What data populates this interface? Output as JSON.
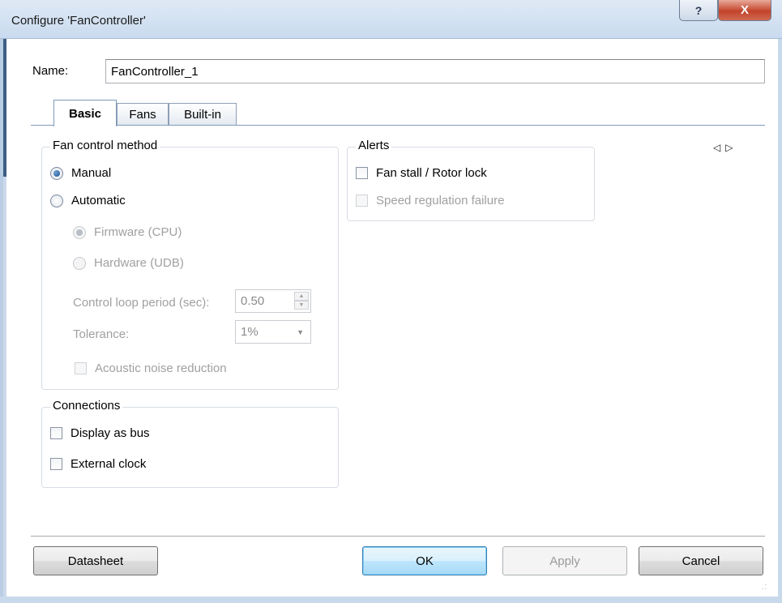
{
  "window": {
    "title": "Configure 'FanController'",
    "help_glyph": "?",
    "close_glyph": "X"
  },
  "name_row": {
    "label": "Name:",
    "value": "FanController_1"
  },
  "tabs": [
    {
      "label": "Basic",
      "selected": true
    },
    {
      "label": "Fans",
      "selected": false
    },
    {
      "label": "Built-in",
      "selected": false
    }
  ],
  "tab_scroll": {
    "left": "◁",
    "right": "▷"
  },
  "fan_control": {
    "title": "Fan control method",
    "manual": {
      "label": "Manual",
      "checked": true
    },
    "automatic": {
      "label": "Automatic",
      "checked": false
    },
    "firmware": {
      "label": "Firmware (CPU)",
      "checked": true,
      "enabled": false
    },
    "hardware": {
      "label": "Hardware (UDB)",
      "checked": false,
      "enabled": false
    },
    "control_loop": {
      "label": "Control loop period (sec):",
      "value": "0.50"
    },
    "tolerance": {
      "label": "Tolerance:",
      "value": "1%"
    },
    "acoustic": {
      "label": "Acoustic noise reduction",
      "checked": false,
      "enabled": false
    }
  },
  "alerts": {
    "title": "Alerts",
    "fan_stall": {
      "label": "Fan stall / Rotor lock",
      "checked": false
    },
    "speed_failure": {
      "label": "Speed regulation failure",
      "checked": false,
      "enabled": false
    }
  },
  "connections": {
    "title": "Connections",
    "display_bus": {
      "label": "Display as bus",
      "checked": false
    },
    "external_clock": {
      "label": "External clock",
      "checked": false
    }
  },
  "buttons": {
    "datasheet": "Datasheet",
    "ok": "OK",
    "apply": "Apply",
    "cancel": "Cancel"
  },
  "colors": {
    "titlebar": "#c9dbef",
    "close_button": "#c3442b",
    "ok_button_border": "#3c7fb1",
    "tab_border": "#7e9ab9",
    "disabled_text": "#a0a0a0"
  }
}
